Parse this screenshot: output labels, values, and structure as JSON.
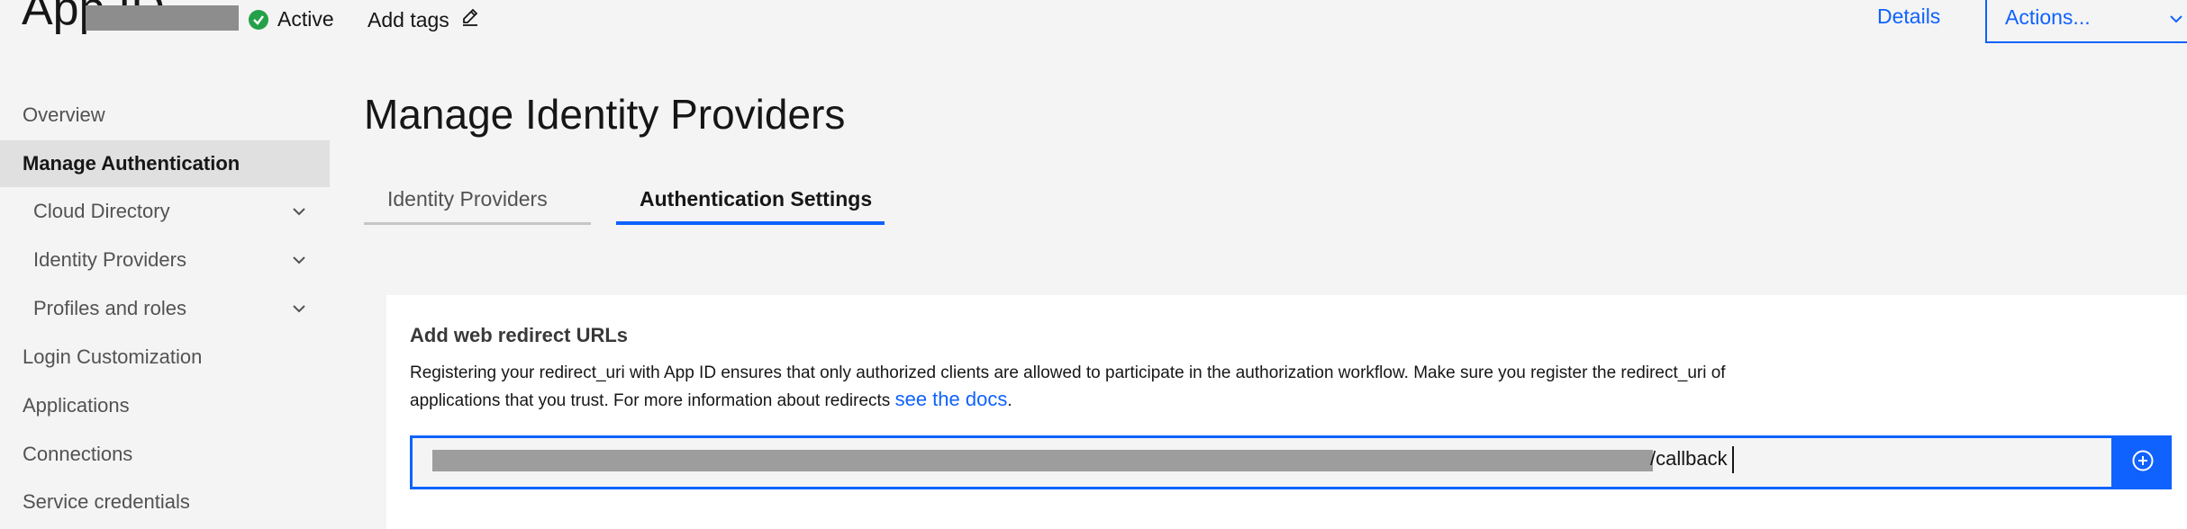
{
  "header": {
    "app_title": "App ID",
    "status": "Active",
    "add_tags": "Add tags",
    "details": "Details",
    "actions": "Actions..."
  },
  "sidebar": {
    "items": [
      {
        "label": "Overview"
      },
      {
        "label": "Manage Authentication"
      },
      {
        "label": "Cloud Directory"
      },
      {
        "label": "Identity Providers"
      },
      {
        "label": "Profiles and roles"
      },
      {
        "label": "Login Customization"
      },
      {
        "label": "Applications"
      },
      {
        "label": "Connections"
      },
      {
        "label": "Service credentials"
      }
    ]
  },
  "main": {
    "title": "Manage Identity Providers",
    "tabs": [
      {
        "label": "Identity Providers"
      },
      {
        "label": "Authentication Settings"
      }
    ],
    "panel": {
      "title": "Add web redirect URLs",
      "description": "Registering your redirect_uri with App ID ensures that only authorized clients are allowed to participate in the authorization workflow. Make sure you register the redirect_uri of applications that you trust. For more information about redirects",
      "docs_link": "see the docs",
      "period": ".",
      "url_value_suffix": "/callback"
    }
  },
  "colors": {
    "accent": "#0f62fe",
    "status_green": "#24a148",
    "background": "#f4f4f4",
    "active_nav": "#e0e0e0"
  },
  "icons": [
    "checkmark-circle-icon",
    "edit-icon",
    "chevron-down-icon",
    "add-circle-icon"
  ]
}
